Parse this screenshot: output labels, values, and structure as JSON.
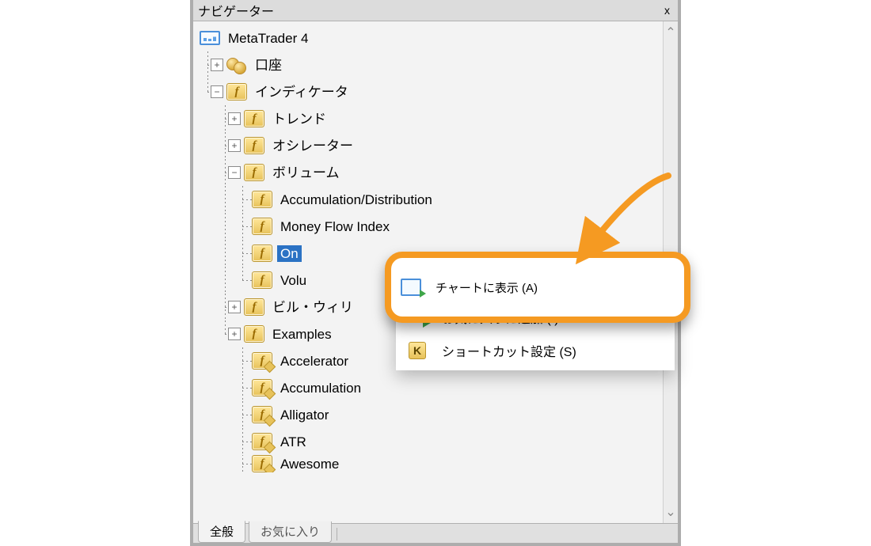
{
  "window": {
    "title": "ナビゲーター",
    "close_glyph": "x"
  },
  "tree": {
    "root": "MetaTrader 4",
    "accounts": "口座",
    "indicators": "インディケータ",
    "trend": "トレンド",
    "oscillator": "オシレーター",
    "volume": {
      "label": "ボリューム",
      "items": {
        "accdist": "Accumulation/Distribution",
        "mfi": "Money Flow Index",
        "obv_short": "On",
        "volumes_trunc": "Volu"
      }
    },
    "bill_williams": "ビル・ウィリ",
    "examples": {
      "label": "Examples",
      "items": {
        "accelerator": "Accelerator",
        "accumulation": "Accumulation",
        "alligator": "Alligator",
        "atr": "ATR",
        "awesome": "Awesome"
      }
    }
  },
  "context_menu": {
    "attach": "チャートに表示 (A)",
    "favorite": "お気に入りに追加 (I)",
    "shortcut": "ショートカット設定 (S)"
  },
  "tabs": {
    "general": "全般",
    "favorites": "お気に入り"
  },
  "expanders": {
    "plus": "+",
    "minus": "−"
  },
  "scroll": {
    "up": "⌃",
    "down": "⌄"
  }
}
